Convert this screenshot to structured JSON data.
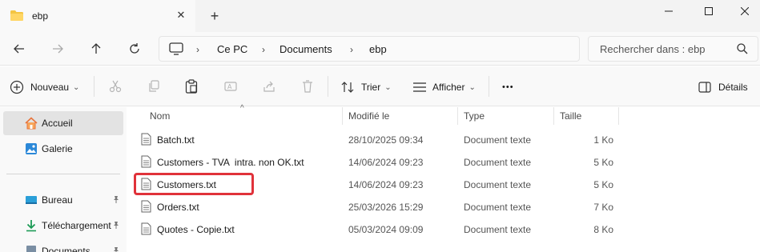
{
  "window": {
    "tab_title": "ebp",
    "new_tab": "+",
    "close_tab": "✕",
    "controls": {
      "minimize": "—",
      "maximize": "☐",
      "close": "✕"
    }
  },
  "address": {
    "root_label": "Ce PC",
    "crumbs": [
      "Ce PC",
      "Documents",
      "ebp"
    ],
    "separator": "›",
    "search_placeholder": "Rechercher dans : ebp"
  },
  "toolbar": {
    "new_label": "Nouveau",
    "sort_label": "Trier",
    "view_label": "Afficher",
    "more_label": "•••",
    "details_label": "Détails",
    "dropdown_glyph": "⌄"
  },
  "sidebar": {
    "items": [
      {
        "label": "Accueil",
        "icon": "home-icon",
        "pinned": false
      },
      {
        "label": "Galerie",
        "icon": "gallery-icon",
        "pinned": false
      },
      {
        "label": "Bureau",
        "icon": "desktop-icon",
        "pinned": true
      },
      {
        "label": "Téléchargement",
        "icon": "download-icon",
        "pinned": true
      },
      {
        "label": "Documents",
        "icon": "documents-icon",
        "pinned": true
      }
    ],
    "pin_glyph": "📌"
  },
  "files": {
    "columns": [
      "Nom",
      "Modifié le",
      "Type",
      "Taille"
    ],
    "sort_glyph": "^",
    "rows": [
      {
        "name": "Batch.txt",
        "modified": "28/10/2025 09:34",
        "type": "Document texte",
        "size": "1 Ko"
      },
      {
        "name": "Customers - TVA  intra. non OK.txt",
        "modified": "14/06/2024 09:23",
        "type": "Document texte",
        "size": "5 Ko"
      },
      {
        "name": "Customers.txt",
        "modified": "14/06/2024 09:23",
        "type": "Document texte",
        "size": "5 Ko"
      },
      {
        "name": "Orders.txt",
        "modified": "25/03/2026 15:29",
        "type": "Document texte",
        "size": "7 Ko"
      },
      {
        "name": "Quotes - Copie.txt",
        "modified": "05/03/2024 09:09",
        "type": "Document texte",
        "size": "8 Ko"
      }
    ]
  },
  "colors": {
    "highlight": "#e0323a",
    "accent": "#0067c0",
    "folder": "#f4c542"
  }
}
